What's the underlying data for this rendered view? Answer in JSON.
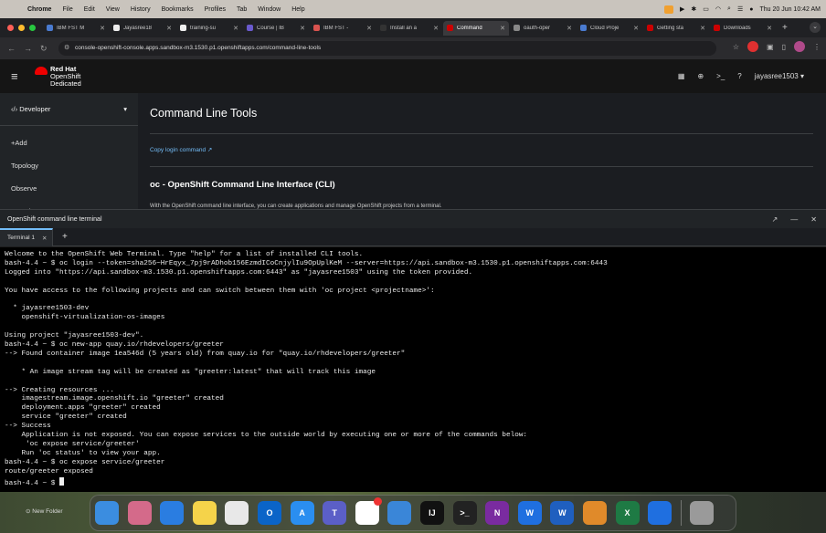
{
  "menubar": {
    "app": "Chrome",
    "items": [
      "File",
      "Edit",
      "View",
      "History",
      "Bookmarks",
      "Profiles",
      "Tab",
      "Window",
      "Help"
    ],
    "datetime": "Thu 20 Jun  10:42 AM"
  },
  "browser": {
    "tabs": [
      {
        "label": "IBM FST M",
        "color": "#4a7bd0",
        "active": false
      },
      {
        "label": "Jayasree18",
        "color": "#eeeeee",
        "active": false
      },
      {
        "label": "training-su",
        "color": "#eeeeee",
        "active": false
      },
      {
        "label": "Course | IB",
        "color": "#6a5acd",
        "active": false
      },
      {
        "label": "IBM FST -",
        "color": "#d9534f",
        "active": false
      },
      {
        "label": "Install an a",
        "color": "#333333",
        "active": false
      },
      {
        "label": "Command",
        "color": "#cc0000",
        "active": true
      },
      {
        "label": "oauth-oper",
        "color": "#888888",
        "active": false
      },
      {
        "label": "Cloud Proje",
        "color": "#4a7bd0",
        "active": false
      },
      {
        "label": "Getting sta",
        "color": "#cc0000",
        "active": false
      },
      {
        "label": "Downloads",
        "color": "#cc0000",
        "active": false
      }
    ],
    "url": "console-openshift-console.apps.sandbox-m3.1530.p1.openshiftapps.com/command-line-tools"
  },
  "header": {
    "brand_line1": "Red Hat",
    "brand_line2": "OpenShift",
    "brand_line3": "Dedicated",
    "user": "jayasree1503 ▾"
  },
  "sidebar": {
    "perspective": "Developer",
    "items": [
      "+Add",
      "Topology",
      "Observe",
      "Search"
    ]
  },
  "main": {
    "title": "Command Line Tools",
    "login_link": "Copy login command",
    "section_title": "oc - OpenShift Command Line Interface (CLI)",
    "section_text": "With the OpenShift command line interface, you can create applications and manage OpenShift projects from a terminal."
  },
  "terminal_panel": {
    "title": "OpenShift command line terminal",
    "tab_label": "Terminal 1",
    "lines": [
      "Welcome to the OpenShift Web Terminal. Type \"help\" for a list of installed CLI tools.",
      "bash-4.4 ~ $ oc login --token=sha256~HrEqyx_7pj9rADhob156EzmdICoCnjylIu9OpUplKeM --server=https://api.sandbox-m3.1530.p1.openshiftapps.com:6443",
      "Logged into \"https://api.sandbox-m3.1530.p1.openshiftapps.com:6443\" as \"jayasree1503\" using the token provided.",
      "",
      "You have access to the following projects and can switch between them with 'oc project <projectname>':",
      "",
      "  * jayasree1503-dev",
      "    openshift-virtualization-os-images",
      "",
      "Using project \"jayasree1503-dev\".",
      "bash-4.4 ~ $ oc new-app quay.io/rhdevelopers/greeter",
      "--> Found container image 1ea546d (5 years old) from quay.io for \"quay.io/rhdevelopers/greeter\"",
      "",
      "    * An image stream tag will be created as \"greeter:latest\" that will track this image",
      "",
      "--> Creating resources ...",
      "    imagestream.image.openshift.io \"greeter\" created",
      "    deployment.apps \"greeter\" created",
      "    service \"greeter\" created",
      "--> Success",
      "    Application is not exposed. You can expose services to the outside world by executing one or more of the commands below:",
      "     'oc expose service/greeter'",
      "    Run 'oc status' to view your app.",
      "bash-4.4 ~ $ oc expose service/greeter",
      "route/greeter exposed"
    ],
    "prompt": "bash-4.4 ~ $ "
  },
  "desktop": {
    "new_folder": "New Folder",
    "dock": [
      {
        "name": "finder",
        "color": "#3b8de0",
        "glyph": ""
      },
      {
        "name": "launchpad",
        "color": "#d46a8a",
        "glyph": ""
      },
      {
        "name": "safari",
        "color": "#2a7de1",
        "glyph": ""
      },
      {
        "name": "notes",
        "color": "#f5d34a",
        "glyph": ""
      },
      {
        "name": "chrome",
        "color": "#e8e8e8",
        "glyph": ""
      },
      {
        "name": "outlook",
        "color": "#0a64c8",
        "glyph": "O"
      },
      {
        "name": "app-store",
        "color": "#2a8ef0",
        "glyph": "A"
      },
      {
        "name": "teams",
        "color": "#5b5fc7",
        "glyph": "T"
      },
      {
        "name": "slack",
        "color": "#ffffff",
        "glyph": ""
      },
      {
        "name": "xcode",
        "color": "#3a86d8",
        "glyph": ""
      },
      {
        "name": "intellij",
        "color": "#111111",
        "glyph": "IJ"
      },
      {
        "name": "terminal",
        "color": "#222222",
        "glyph": ">_"
      },
      {
        "name": "onenote",
        "color": "#7a2ba0",
        "glyph": "N"
      },
      {
        "name": "webex",
        "color": "#1f6fe0",
        "glyph": "W"
      },
      {
        "name": "word",
        "color": "#1f5fbf",
        "glyph": "W"
      },
      {
        "name": "preview",
        "color": "#e08a2a",
        "glyph": ""
      },
      {
        "name": "excel",
        "color": "#1e7a44",
        "glyph": "X"
      },
      {
        "name": "webex-meetings",
        "color": "#1f6fe0",
        "glyph": ""
      },
      {
        "name": "trash",
        "color": "#9a9a9a",
        "glyph": ""
      }
    ]
  }
}
